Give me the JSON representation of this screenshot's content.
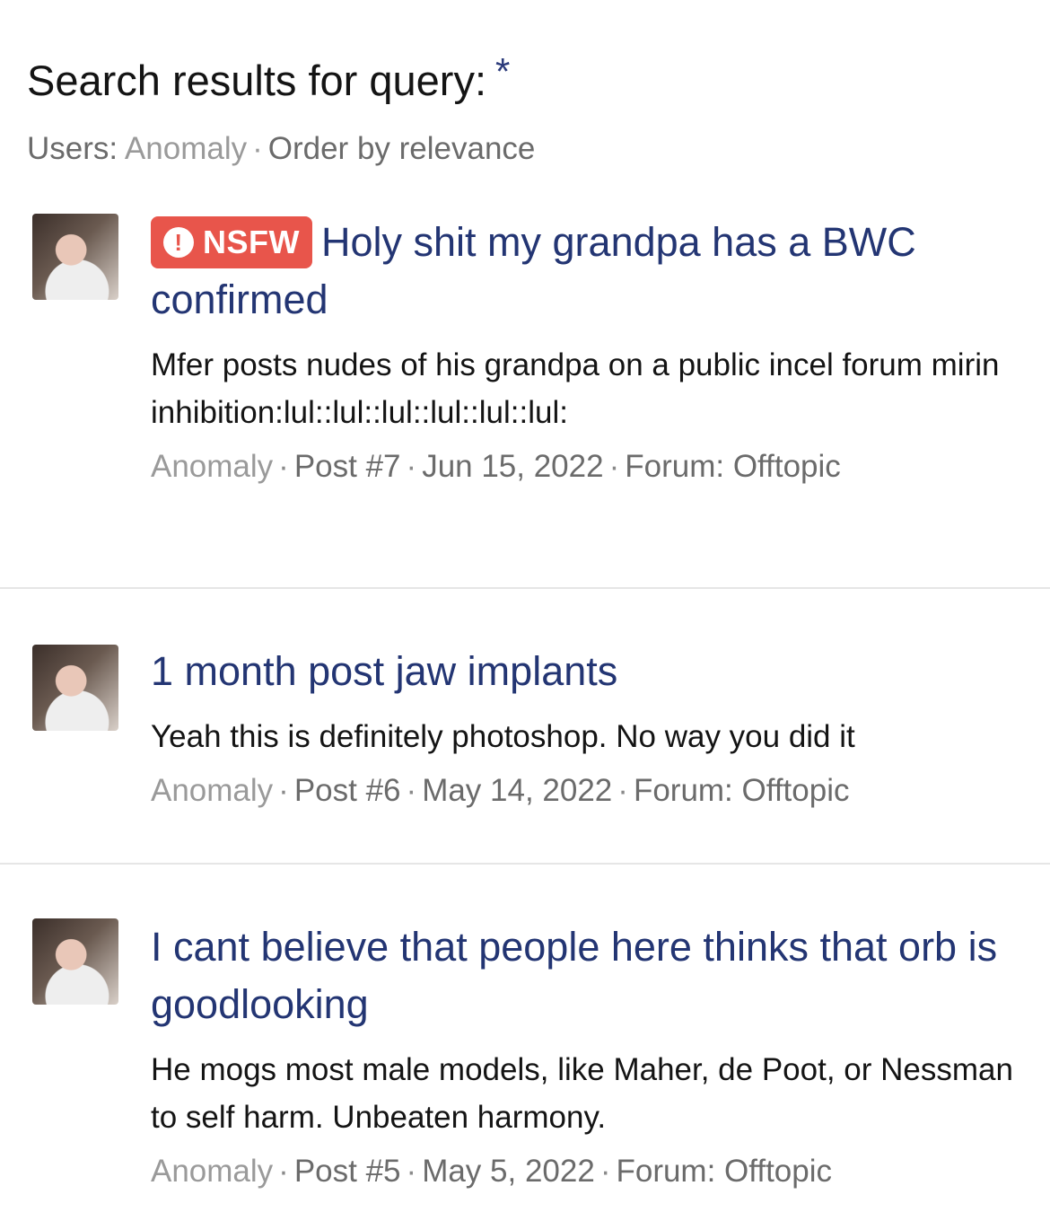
{
  "header": {
    "title": "Search results for query:",
    "query": "*",
    "users_label": "Users:",
    "user": "Anomaly",
    "order": "Order by relevance"
  },
  "results": [
    {
      "badge": "NSFW",
      "title": "Holy shit my grandpa has a BWC confirmed",
      "snippet": "Mfer posts nudes of his grandpa on a public incel forum mirin inhibition:lul::lul::lul::lul::lul::lul:",
      "author": "Anomaly",
      "post": "Post #7",
      "date": "Jun 15, 2022",
      "forum": "Forum: Offtopic"
    },
    {
      "title": "1 month post jaw implants",
      "snippet": "Yeah this is definitely photoshop. No way you did it",
      "author": "Anomaly",
      "post": "Post #6",
      "date": "May 14, 2022",
      "forum": "Forum: Offtopic"
    },
    {
      "title": "I cant believe that people here thinks that orb is goodlooking",
      "snippet": "He mogs most male models, like Maher, de Poot, or Nessman to self harm. Unbeaten harmony.",
      "author": "Anomaly",
      "post": "Post #5",
      "date": "May 5, 2022",
      "forum": "Forum: Offtopic"
    }
  ],
  "icons": {
    "badge_icon": "exclamation-circle-icon",
    "avatar": "user-avatar-photo"
  },
  "colors": {
    "link": "#233573",
    "nsfw_badge": "#e8554b",
    "muted": "#9a9a9a"
  }
}
